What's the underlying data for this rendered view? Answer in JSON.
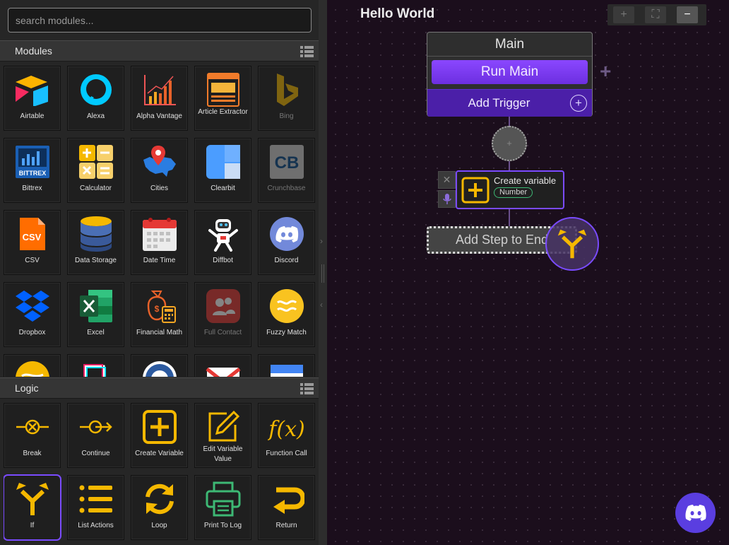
{
  "search": {
    "placeholder": "search modules..."
  },
  "modules": {
    "title": "Modules",
    "items": [
      {
        "label": "Airtable"
      },
      {
        "label": "Alexa"
      },
      {
        "label": "Alpha Vantage"
      },
      {
        "label": "Article Extractor"
      },
      {
        "label": "Bing",
        "disabled": true
      },
      {
        "label": "Bittrex"
      },
      {
        "label": "Calculator"
      },
      {
        "label": "Cities"
      },
      {
        "label": "Clearbit"
      },
      {
        "label": "Crunchbase",
        "disabled": true
      },
      {
        "label": "CSV"
      },
      {
        "label": "Data Storage"
      },
      {
        "label": "Date Time"
      },
      {
        "label": "Diffbot"
      },
      {
        "label": "Discord"
      },
      {
        "label": "Dropbox"
      },
      {
        "label": "Excel"
      },
      {
        "label": "Financial Math"
      },
      {
        "label": "Full Contact",
        "disabled": true
      },
      {
        "label": "Fuzzy Match"
      }
    ]
  },
  "logic": {
    "title": "Logic",
    "items": [
      {
        "label": "Break"
      },
      {
        "label": "Continue"
      },
      {
        "label": "Create Variable"
      },
      {
        "label": "Edit Variable Value"
      },
      {
        "label": "Function Call"
      },
      {
        "label": "If"
      },
      {
        "label": "List Actions"
      },
      {
        "label": "Loop"
      },
      {
        "label": "Print To Log"
      },
      {
        "label": "Return"
      }
    ]
  },
  "canvas": {
    "flow_title": "Hello World",
    "zoom": {
      "zoom_in": "+",
      "fit": "⛶",
      "zoom_out": "−"
    },
    "main_node": {
      "title": "Main",
      "run_label": "Run Main",
      "trigger_label": "Add Trigger"
    },
    "step": {
      "title": "Create variable",
      "badge": "Number"
    },
    "add_end_label": "Add Step to End"
  },
  "colors": {
    "accent": "#7a4bff",
    "icon_yellow": "#f5b800",
    "badge_green": "#3db874"
  }
}
